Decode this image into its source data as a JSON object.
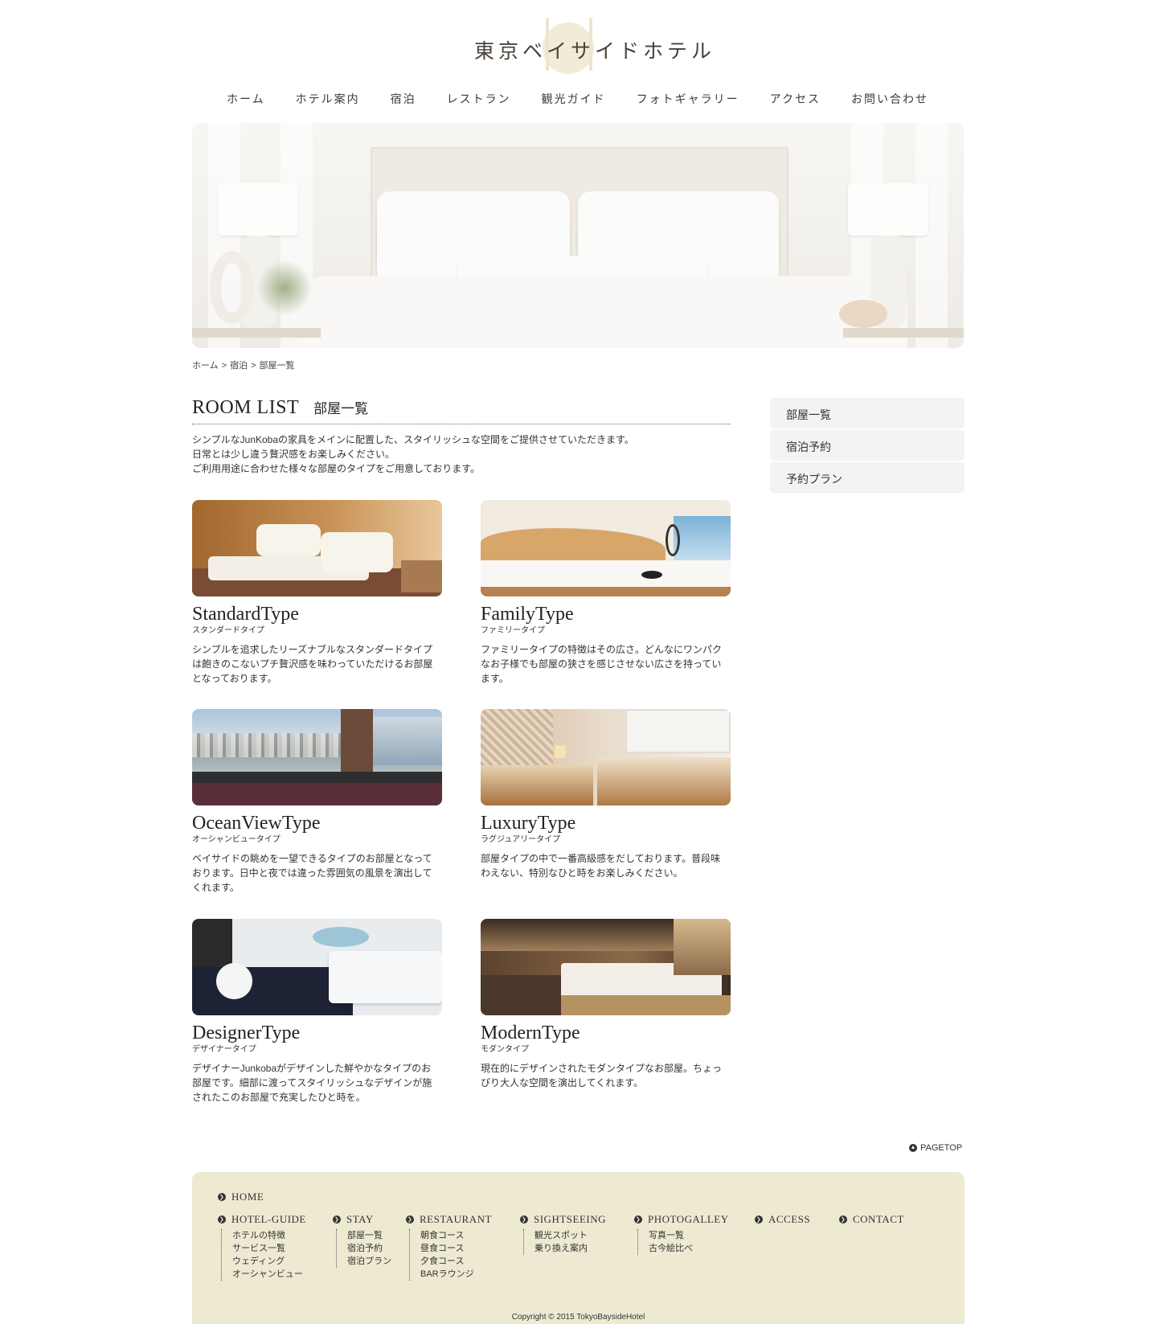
{
  "header": {
    "logo_text": "東京ベイサイドホテル",
    "nav": [
      "ホーム",
      "ホテル案内",
      "宿泊",
      "レストラン",
      "観光ガイド",
      "フォトギャラリー",
      "アクセス",
      "お問い合わせ"
    ]
  },
  "breadcrumb": [
    "ホーム",
    ">",
    "宿泊",
    ">",
    "部屋一覧"
  ],
  "main": {
    "title_en": "ROOM LIST",
    "title_jp": "部屋一覧",
    "intro": [
      "シンプルなJunKobaの家具をメインに配置した、スタイリッシュな空間をご提供させていただきます。",
      "日常とは少し違う贅沢感をお楽しみください。",
      "ご利用用途に合わせた様々な部屋のタイプをご用意しております。"
    ],
    "rooms": [
      {
        "name": "StandardType",
        "kana": "スタンダードタイプ",
        "desc": [
          "シンプルを追求したリーズナブルなスタンダードタイプ",
          "は飽きのこないプチ贅沢感を味わっていただけるお部屋",
          "となっております。"
        ]
      },
      {
        "name": "FamilyType",
        "kana": "ファミリータイプ",
        "desc": [
          "ファミリータイプの特徴はその広さ。どんなにワンパク",
          "なお子様でも部屋の狭さを感じさせない広さを持ってい",
          "ます。"
        ]
      },
      {
        "name": "OceanViewType",
        "kana": "オーシャンビュータイプ",
        "desc": [
          "ベイサイドの眺めを一望できるタイプのお部屋となって",
          "おります。日中と夜では違った雰囲気の風景を演出して",
          "くれます。"
        ]
      },
      {
        "name": "LuxuryType",
        "kana": "ラグジュアリータイプ",
        "desc": [
          "部屋タイプの中で一番高級感をだしております。普段味",
          "わえない、特別なひと時をお楽しみください。"
        ]
      },
      {
        "name": "DesignerType",
        "kana": "デザイナータイプ",
        "desc": [
          "デザイナーJunkobaがデザインした鮮やかなタイプのお",
          "部屋です。細部に渡ってスタイリッシュなデザインが施",
          "されたこのお部屋で充実したひと時を。"
        ]
      },
      {
        "name": "ModernType",
        "kana": "モダンタイプ",
        "desc": [
          "現在的にデザインされたモダンタイプなお部屋。ちょっ",
          "ぴり大人な空間を演出してくれます。"
        ]
      }
    ]
  },
  "sidenav": [
    "部屋一覧",
    "宿泊予約",
    "予約プラン"
  ],
  "pagetop": "PAGETOP",
  "footer": {
    "home": "HOME",
    "columns": [
      {
        "title": "HOTEL-GUIDE",
        "items": [
          "ホテルの特徴",
          "サービス一覧",
          "ウェディング",
          "オーシャンビュー"
        ]
      },
      {
        "title": "STAY",
        "items": [
          "部屋一覧",
          "宿泊予約",
          "宿泊プラン"
        ]
      },
      {
        "title": "RESTAURANT",
        "items": [
          "朝食コース",
          "昼食コース",
          "夕食コース",
          "BARラウンジ"
        ]
      },
      {
        "title": "SIGHTSEEING",
        "items": [
          "観光スポット",
          "乗り換え案内"
        ]
      },
      {
        "title": "PHOTOGALLEY",
        "items": [
          "写真一覧",
          "古今絵比べ"
        ]
      },
      {
        "title": "ACCESS",
        "items": []
      },
      {
        "title": "CONTACT",
        "items": []
      }
    ],
    "copyright": "Copyright © 2015 TokyoBaysideHotel"
  },
  "colors": {
    "footer_bg": "#eeead2",
    "logo_accent": "#f1ecd6",
    "sidenav_bg": "#f3f3f3"
  }
}
